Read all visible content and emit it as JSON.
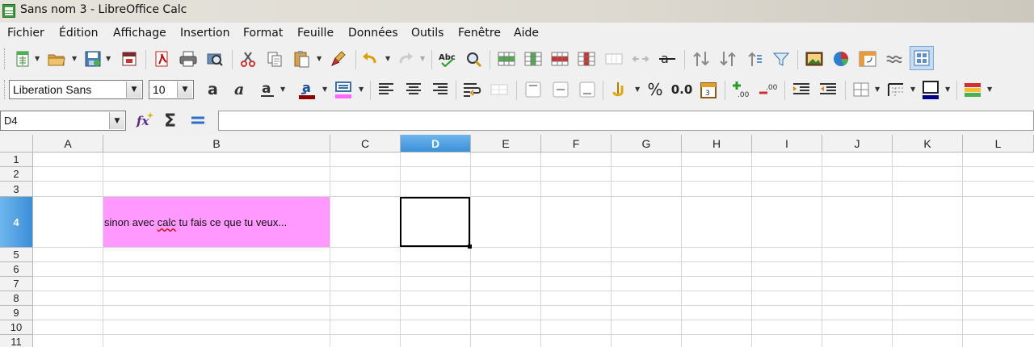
{
  "window": {
    "title": "Sans nom 3 - LibreOffice Calc"
  },
  "menu": [
    "Fichier",
    "Édition",
    "Affichage",
    "Insertion",
    "Format",
    "Feuille",
    "Données",
    "Outils",
    "Fenêtre",
    "Aide"
  ],
  "formatting": {
    "font_name": "Liberation Sans",
    "font_size": "10",
    "percent_label": "%",
    "number_label": "0.0"
  },
  "formula_bar": {
    "name_box": "D4",
    "formula": ""
  },
  "columns": [
    "A",
    "B",
    "C",
    "D",
    "E",
    "F",
    "G",
    "H",
    "I",
    "J",
    "K",
    "L"
  ],
  "rows": [
    "1",
    "2",
    "3",
    "4",
    "5",
    "6",
    "7",
    "8",
    "9",
    "10",
    "11"
  ],
  "active_cell": {
    "column": "D",
    "row": "4"
  },
  "cells": {
    "B4": {
      "before": "sinon avec ",
      "misspelled": "calc",
      "after": " tu fais ce que tu veux...",
      "background": "#ff99ff"
    }
  },
  "colors": {
    "highlight_header": "#3a8fd8",
    "font_color_bar": "#8b0000",
    "highlight_color_bar": "#ff66ff",
    "cell_fill": "#ff99ff"
  }
}
